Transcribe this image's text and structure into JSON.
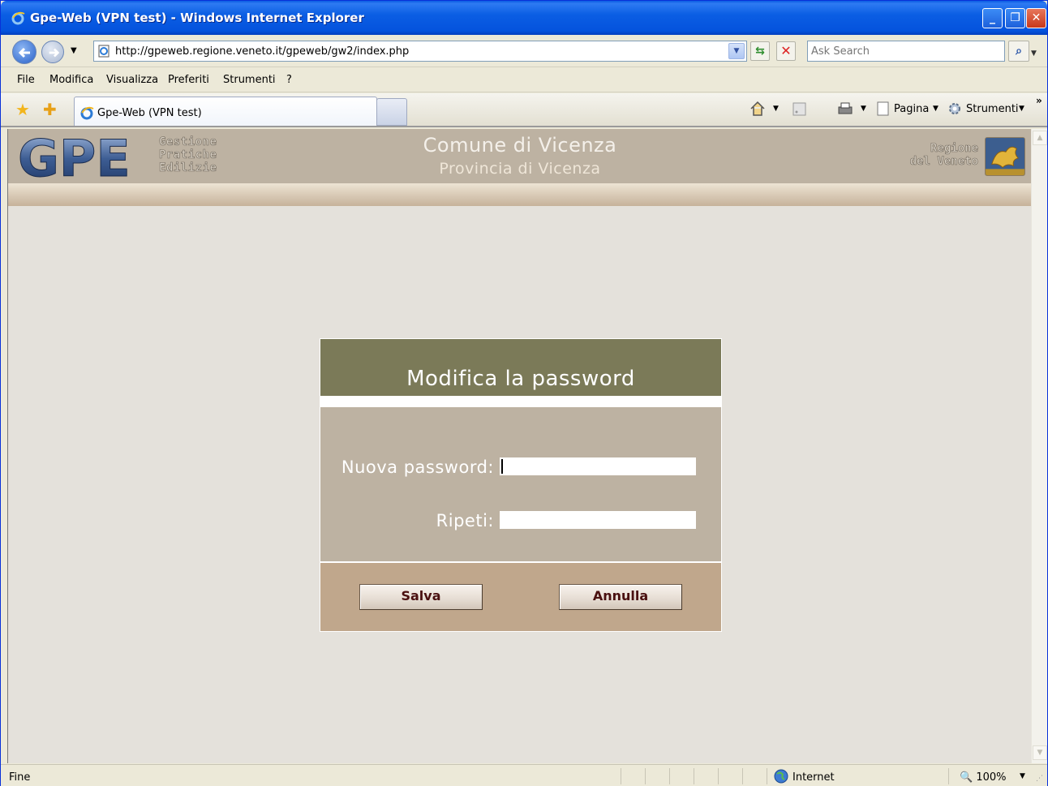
{
  "window": {
    "title": "Gpe-Web (VPN test) - Windows Internet Explorer",
    "minimize": "_",
    "maximize": "❐",
    "close": "✕"
  },
  "address": {
    "url": "http://gpeweb.regione.veneto.it/gpeweb/gw2/index.php",
    "search_placeholder": "Ask Search"
  },
  "menu": [
    "File",
    "Modifica",
    "Visualizza",
    "Preferiti",
    "Strumenti",
    "?"
  ],
  "tab": {
    "label": "Gpe-Web (VPN test)"
  },
  "toolbar": {
    "page_label": "Pagina",
    "tools_label": "Strumenti",
    "more": "»"
  },
  "header": {
    "logo_text": "GPE",
    "logo_sub": [
      "Gestione",
      "Pratiche",
      "Edilizie"
    ],
    "comune": "Comune di Vicenza",
    "provincia": "Provincia di Vicenza",
    "regione": [
      "Regione",
      "del Veneto"
    ]
  },
  "dialog": {
    "title": "Modifica la password",
    "new_password_label": "Nuova password:",
    "repeat_label": "Ripeti:",
    "save_label": "Salva",
    "cancel_label": "Annulla"
  },
  "status": {
    "text": "Fine",
    "zone": "Internet",
    "zoom": "100%"
  },
  "colors": {
    "titlebar": "#0453DD",
    "header_bg": "#BDB2A2",
    "dialog_title_bg": "#7B7A58",
    "dialog_body_bg": "#BDB2A2",
    "dialog_footer_bg": "#C0A78C",
    "content_bg": "#E4E1DB"
  }
}
